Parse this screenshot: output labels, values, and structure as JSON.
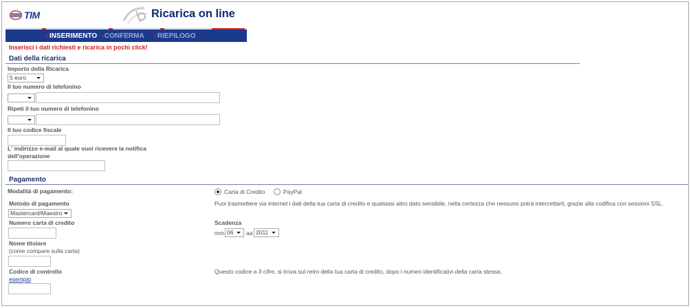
{
  "header": {
    "logo_text": "TIM",
    "title": "Ricarica on line"
  },
  "steps": [
    {
      "label": "INSERIMENTO",
      "active": true
    },
    {
      "label": "CONFERMA",
      "active": false
    },
    {
      "label": "RIEPILOGO",
      "active": false
    }
  ],
  "tagline": "Inserisci i dati richiesti e ricarica in pochi click!",
  "recharge_section": {
    "title": "Dati della ricarica",
    "amount_label": "Importo della Ricarica",
    "amount_value": "5 euro",
    "phone_label": "Il tuo numero di telefonino",
    "phone_repeat_label": "Ripeti il tuo numero di telefonino",
    "tax_code_label": "Il tuo codice fiscale",
    "email_label_line1": "L' indirizzo e-mail al quale vuoi ricevere la notifica",
    "email_label_line2": "dell'operazione"
  },
  "payment_section": {
    "title": "Pagamento",
    "mode_label": "Modalità di pagamento:",
    "option_card": "Carta di Credito",
    "option_paypal": "PayPal",
    "method_label": "Metodo di pagamento",
    "method_value": "Mastercard/Maestro",
    "security_note": "Puoi trasmettere via internet i dati della tua carta di credito e qualsiasi altro dato sensibile, nella certezza che nessuno potrà  intercettarli, grazie alla codifica con sessioni SSL.",
    "card_number_label": "Numero carta di credito",
    "expiry_label": "Scadenza",
    "month_prefix": "mm",
    "month_value": "06",
    "year_prefix": "aa",
    "year_value": "2011",
    "holder_label": "Nome titolare",
    "holder_hint": "(come compare sulla carta)",
    "cvv_label": "Codice di controllo",
    "cvv_example_link": "esempio",
    "cvv_note": "Questo codice a 3 cifre, si trova sul retro della tua carta di credito, dopo i numeri identificativi della carta stessa."
  },
  "colors": {
    "brand_blue": "#1c3a8c",
    "accent_red": "#d2201f"
  }
}
